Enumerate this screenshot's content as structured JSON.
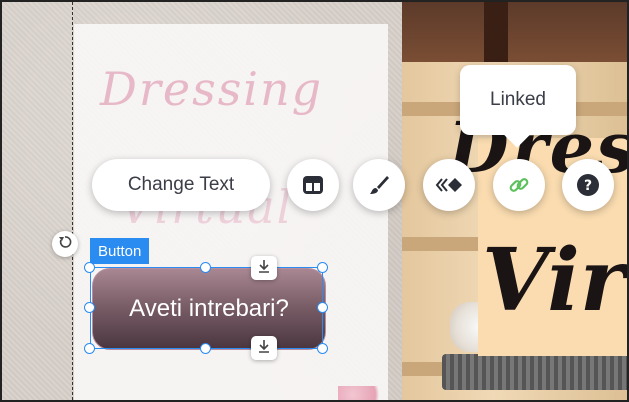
{
  "toolbar": {
    "change_text_label": "Change Text",
    "icons": {
      "layout": "layout-icon",
      "design": "paintbrush-icon",
      "animation": "animation-icon",
      "link": "link-icon",
      "help": "help-icon"
    }
  },
  "tooltip": {
    "text": "Linked"
  },
  "selected_element": {
    "type_label": "Button",
    "button_text": "Aveti intrebari?"
  },
  "colors": {
    "selection_blue": "#2a8bf0",
    "link_green": "#5cc05c",
    "toolbar_icon": "#2b2d37"
  }
}
